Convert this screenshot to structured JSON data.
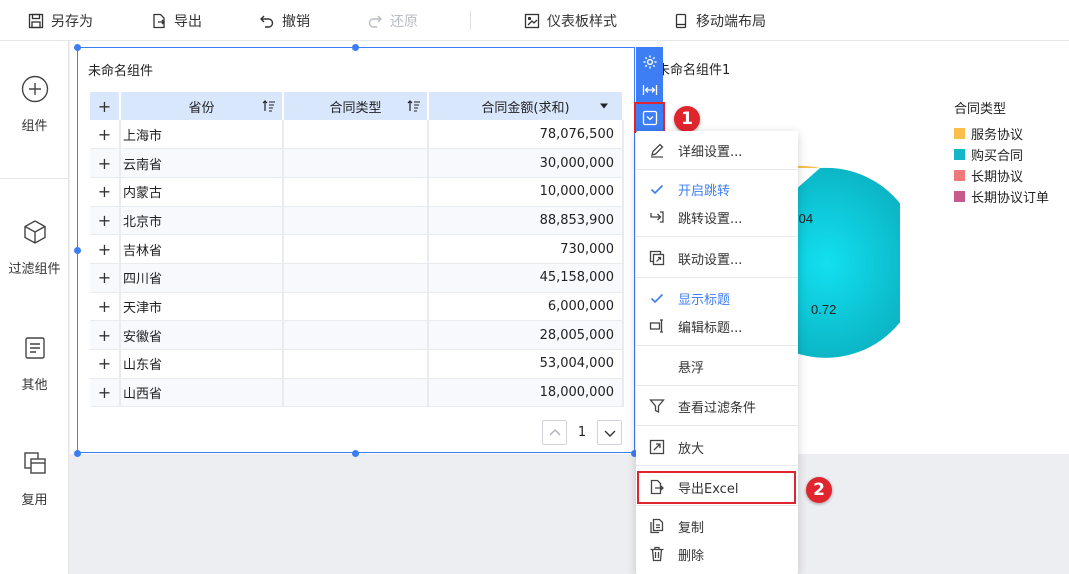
{
  "toolbar": {
    "save_as": "另存为",
    "export": "导出",
    "undo": "撤销",
    "redo": "还原",
    "dashboard_style": "仪表板样式",
    "mobile_layout": "移动端布局"
  },
  "sidebar": {
    "items": [
      {
        "label": "组件",
        "icon": "plus-circle-icon"
      },
      {
        "label": "过滤组件",
        "icon": "cube-icon"
      },
      {
        "label": "其他",
        "icon": "document-icon"
      },
      {
        "label": "复用",
        "icon": "copy-stack-icon"
      }
    ]
  },
  "table_widget": {
    "title": "未命名组件",
    "columns": [
      "省份",
      "合同类型",
      "合同金额(求和)"
    ],
    "expand_symbol": "+",
    "rows": [
      {
        "province": "上海市",
        "amount": "78,076,500"
      },
      {
        "province": "云南省",
        "amount": "30,000,000"
      },
      {
        "province": "内蒙古",
        "amount": "10,000,000"
      },
      {
        "province": "北京市",
        "amount": "88,853,900"
      },
      {
        "province": "吉林省",
        "amount": "730,000"
      },
      {
        "province": "四川省",
        "amount": "45,158,000"
      },
      {
        "province": "天津市",
        "amount": "6,000,000"
      },
      {
        "province": "安徽省",
        "amount": "28,005,000"
      },
      {
        "province": "山东省",
        "amount": "53,004,000"
      },
      {
        "province": "山西省",
        "amount": "18,000,000"
      }
    ],
    "page": "1"
  },
  "pie_widget": {
    "title": "未命名组件1",
    "legend_title": "合同类型",
    "legend": [
      {
        "label": "服务协议",
        "color": "#f9bf4a"
      },
      {
        "label": "购买合同",
        "color": "#13b5c8"
      },
      {
        "label": "长期协议",
        "color": "#f1797a"
      },
      {
        "label": "长期协议订单",
        "color": "#c85a8b"
      }
    ],
    "visible_labels": [
      ".04",
      "0.72"
    ]
  },
  "context_menu": {
    "items": [
      {
        "label": "详细设置...",
        "icon": "pencil-icon",
        "active": false
      },
      {
        "label": "开启跳转",
        "icon": "check-icon",
        "active": true
      },
      {
        "label": "跳转设置...",
        "icon": "jump-arrow-icon",
        "active": false
      },
      {
        "label": "联动设置...",
        "icon": "link-window-icon",
        "active": false
      },
      {
        "label": "显示标题",
        "icon": "check-icon",
        "active": true
      },
      {
        "label": "编辑标题...",
        "icon": "edit-title-icon",
        "active": false
      },
      {
        "label": "悬浮",
        "icon": "",
        "active": false
      },
      {
        "label": "查看过滤条件",
        "icon": "filter-icon",
        "active": false
      },
      {
        "label": "放大",
        "icon": "zoom-icon",
        "active": false
      },
      {
        "label": "导出Excel",
        "icon": "export-file-icon",
        "active": false
      },
      {
        "label": "复制",
        "icon": "copy-icon",
        "active": false
      },
      {
        "label": "删除",
        "icon": "trash-icon",
        "active": false
      }
    ]
  },
  "callouts": {
    "first": "1",
    "second": "2"
  },
  "colors": {
    "accent": "#3d7ef5",
    "highlight": "#e0252e",
    "header_bg": "#d9e7fd"
  }
}
